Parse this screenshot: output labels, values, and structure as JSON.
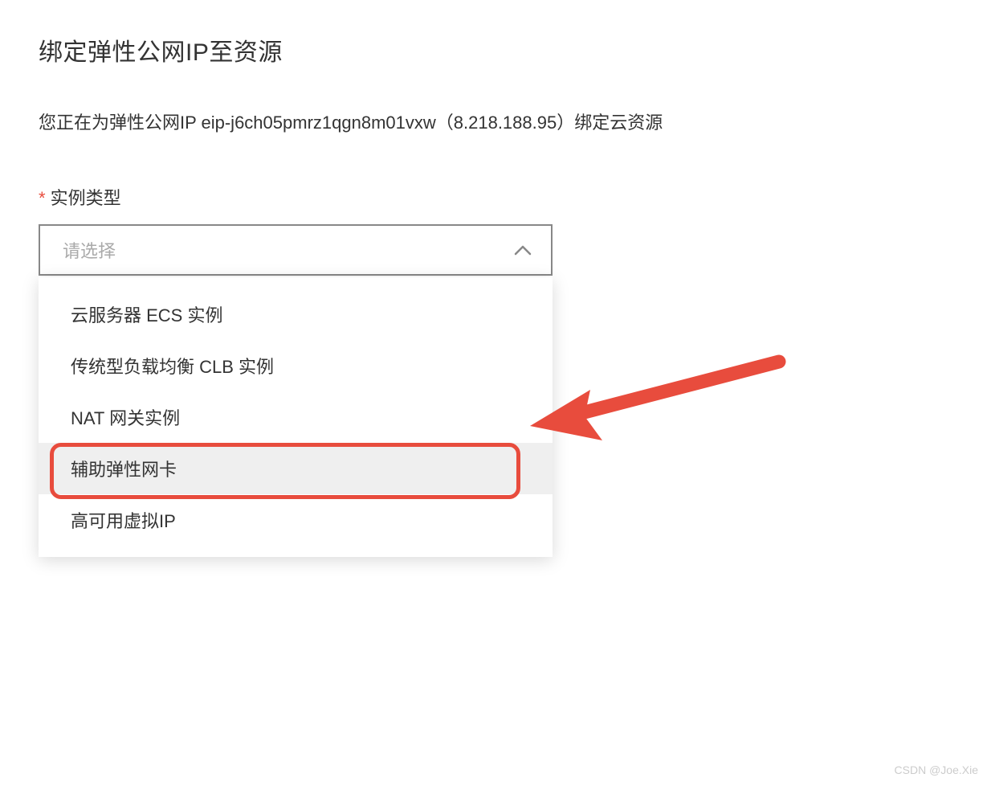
{
  "page_title": "绑定弹性公网IP至资源",
  "description": "您正在为弹性公网IP eip-j6ch05pmrz1qgn8m01vxw（8.218.188.95）绑定云资源",
  "form": {
    "instance_type_label": "实例类型",
    "select_placeholder": "请选择",
    "options": [
      "云服务器 ECS 实例",
      "传统型负载均衡 CLB 实例",
      "NAT 网关实例",
      "辅助弹性网卡",
      "高可用虚拟IP"
    ]
  },
  "watermark": "CSDN @Joe.Xie",
  "annotation": {
    "arrow_color": "#e84c3d",
    "highlight_color": "#e84c3d"
  }
}
